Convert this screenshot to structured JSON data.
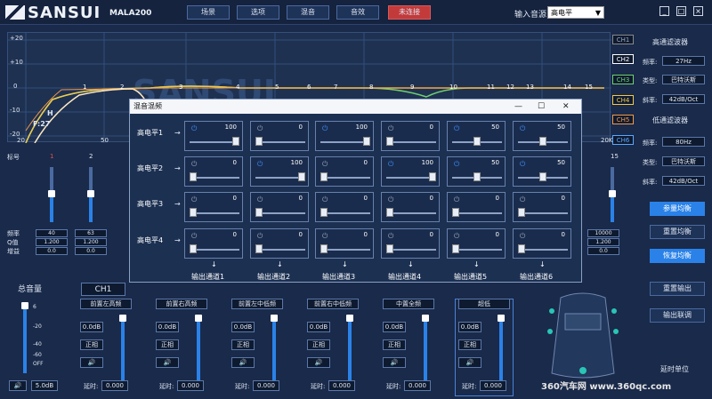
{
  "app": {
    "logo": "SANSUI",
    "model": "MALA200"
  },
  "topnav": {
    "buttons": [
      "场景",
      "选项",
      "混音",
      "音效"
    ],
    "status": "未连接"
  },
  "source": {
    "label": "输入音源",
    "value": "高电平"
  },
  "window_controls": [
    "_",
    "□",
    "×"
  ],
  "graph": {
    "channels": [
      "CH1",
      "CH2",
      "CH3",
      "CH4",
      "CH5",
      "CH6"
    ],
    "channel_colors": [
      "#9aa7bd",
      "#ffffff",
      "#6fd06f",
      "#f2c94c",
      "#f2994a",
      "#5aa8ff"
    ],
    "y_ticks": [
      "+20",
      "+10",
      "0",
      "-10",
      "-20"
    ],
    "x_ticks": [
      "20",
      "50",
      "20K"
    ],
    "band_numbers": [
      "1",
      "2",
      "3",
      "4",
      "5",
      "6",
      "7",
      "8",
      "9",
      "10",
      "11",
      "12",
      "13",
      "14",
      "15"
    ],
    "marker_h": "H",
    "marker_f": "F:27"
  },
  "right": {
    "hp_title": "高通滤波器",
    "hp_freq_label": "频率:",
    "hp_freq": "27Hz",
    "hp_type_label": "类型:",
    "hp_type": "巴特沃斯",
    "hp_slope_label": "斜率:",
    "hp_slope": "42dB/Oct",
    "lp_title": "低通滤波器",
    "lp_freq_label": "频率:",
    "lp_freq": "80Hz",
    "lp_type_label": "类型:",
    "lp_type": "巴特沃斯",
    "lp_slope_label": "斜率:",
    "lp_slope": "42dB/Oct",
    "btn_param_eq": "参量均衡",
    "btn_reset_eq": "重置均衡",
    "btn_restore_eq": "恢复均衡",
    "btn_reset_out": "重置输出",
    "btn_link": "输出联调",
    "delay_unit": "延时单位"
  },
  "eq": {
    "label_band": "标号",
    "row_labels": [
      "频率",
      "Q值",
      "增益"
    ],
    "bands": [
      {
        "num": "1",
        "freq": "40",
        "q": "1.200",
        "gain": "0.0"
      },
      {
        "num": "2",
        "freq": "63",
        "q": "1.200",
        "gain": "0.0"
      },
      {
        "num": "15",
        "freq": "10000",
        "q": "1.200",
        "gain": "0.0"
      }
    ]
  },
  "dialog": {
    "title": "混音混频",
    "controls": [
      "—",
      "☐",
      "✕"
    ],
    "rows": [
      "高电平1",
      "高电平2",
      "高电平3",
      "高电平4"
    ],
    "values": [
      [
        "100",
        "0",
        "100",
        "0",
        "50",
        "50"
      ],
      [
        "0",
        "100",
        "0",
        "100",
        "50",
        "50"
      ],
      [
        "0",
        "0",
        "0",
        "0",
        "0",
        "0"
      ],
      [
        "0",
        "0",
        "0",
        "0",
        "0",
        "0"
      ]
    ],
    "levels": [
      [
        100,
        0,
        100,
        0,
        50,
        50
      ],
      [
        0,
        100,
        0,
        100,
        50,
        50
      ],
      [
        0,
        0,
        0,
        0,
        0,
        0
      ],
      [
        0,
        0,
        0,
        0,
        0,
        0
      ]
    ],
    "outputs": [
      "输出通道1",
      "输出通道2",
      "输出通道3",
      "输出通道4",
      "输出通道5",
      "输出通道6"
    ]
  },
  "bottom": {
    "master_label": "总音量",
    "master_ticks": [
      "6",
      "-20",
      "-40",
      "-60",
      "OFF"
    ],
    "master_value": "5.0dB",
    "ch_select": "CH1",
    "channels": [
      {
        "name": "前置左高频",
        "gain": "0.0dB",
        "phase": "正相",
        "delay_label": "延时:",
        "delay": "0.000"
      },
      {
        "name": "前置右高频",
        "gain": "0.0dB",
        "phase": "正相",
        "delay_label": "延时:",
        "delay": "0.000"
      },
      {
        "name": "前置左中低频",
        "gain": "0.0dB",
        "phase": "正相",
        "delay_label": "延时:",
        "delay": "0.000"
      },
      {
        "name": "前置右中低频",
        "gain": "0.0dB",
        "phase": "正相",
        "delay_label": "延时:",
        "delay": "0.000"
      },
      {
        "name": "中置全频",
        "gain": "0.0dB",
        "phase": "正相",
        "delay_label": "延时:",
        "delay": "0.000"
      },
      {
        "name": "超低",
        "gain": "0.0dB",
        "phase": "正相",
        "delay_label": "延时:",
        "delay": "0.000"
      }
    ]
  },
  "watermark": "360汽车网 www.360qc.com"
}
